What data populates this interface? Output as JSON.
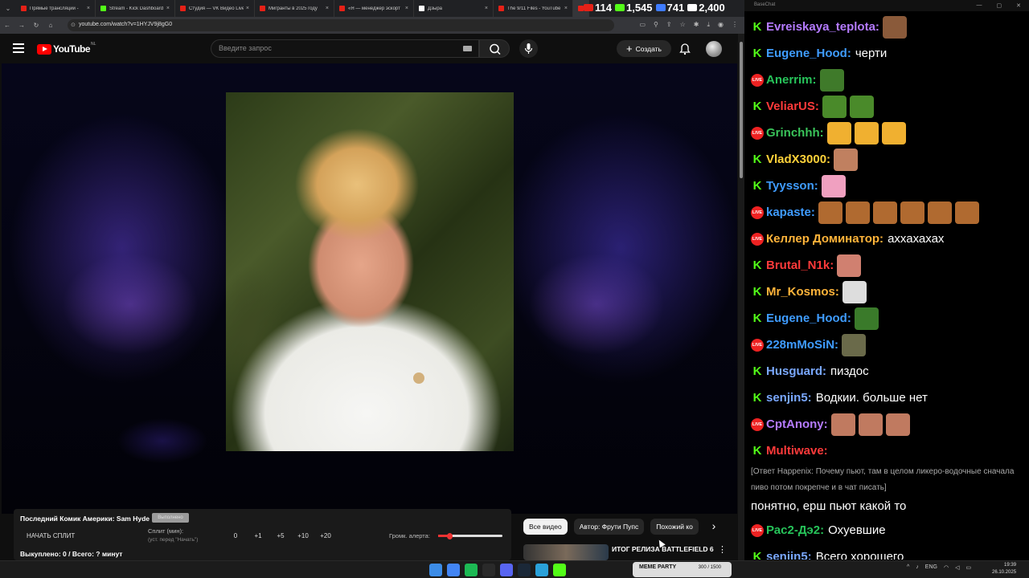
{
  "browser": {
    "tabs": [
      {
        "title": "Прямые трансляции -",
        "fav": "#e62117"
      },
      {
        "title": "Stream - Kick Dashboard",
        "fav": "#53fc18"
      },
      {
        "title": "Студия — VK Видео Live",
        "fav": "#e62117"
      },
      {
        "title": "Мигранты в 2025 году",
        "fav": "#e62117"
      },
      {
        "title": "«Я — менеджер эскорт",
        "fav": "#e62117"
      },
      {
        "title": "Дзыра",
        "fav": "#ffffff"
      },
      {
        "title": "The 9/11 Files - YouTube",
        "fav": "#e62117"
      },
      {
        "title": "Ko",
        "fav": "#e62117"
      }
    ],
    "url": "youtube.com/watch?v=1HYJV9j8gG0"
  },
  "stats": [
    {
      "value": "114",
      "color": "#e62117"
    },
    {
      "value": "1,545",
      "color": "#53fc18"
    },
    {
      "value": "741",
      "color": "#3f7cff"
    },
    {
      "value": "2,400",
      "color": "#ffffff"
    }
  ],
  "youtube": {
    "logo_text": "YouTube",
    "country": "NL",
    "search_placeholder": "Введите запрос",
    "create_label": "Создать"
  },
  "split": {
    "title": "Последний Комик Америки: Sam Hyde",
    "tag": "Выполнено",
    "start_label": "НАЧАТЬ СПЛИТ",
    "split_label": "Сплит (мин):",
    "split_hint": "(уст. перед \"Начать\")",
    "steps": [
      "0",
      "+1",
      "+5",
      "+10",
      "+20"
    ],
    "volume_label": "Громк. алерта:",
    "volume_level": 0.17,
    "bought": "Выкуплено: 0 / Всего: ? минут"
  },
  "chips": [
    "Все видео",
    "Автор: Фрути Пупс",
    "Похожий ко"
  ],
  "recommendation": {
    "title": "ИТОГ РЕЛИЗА BATTLEFIELD 6"
  },
  "chat": {
    "window_title": "BaseChat",
    "messages": [
      {
        "src": "k",
        "user": "Evreiskaya_teplota:",
        "color": "#b57bff",
        "text": "",
        "emotes": [
          "#8a5a3a"
        ]
      },
      {
        "src": "k",
        "user": "Eugene_Hood:",
        "color": "#3f9cff",
        "text": "черти",
        "emotes": []
      },
      {
        "src": "l",
        "user": "Anerrim:",
        "color": "#27c45a",
        "text": "",
        "emotes": [
          "#3f7a2a"
        ]
      },
      {
        "src": "k",
        "user": "VeliarUS:",
        "color": "#ff3a3a",
        "text": "",
        "emotes": [
          "#4a8a2a",
          "#4a8a2a"
        ]
      },
      {
        "src": "l",
        "user": "Grinchhh:",
        "color": "#3ac45a",
        "text": "",
        "emotes": [
          "#f0b030",
          "#f0b030",
          "#f0b030"
        ]
      },
      {
        "src": "k",
        "user": "VladX3000:",
        "color": "#ffd23a",
        "text": "",
        "emotes": [
          "#c08060"
        ]
      },
      {
        "src": "k",
        "user": "Tyysson:",
        "color": "#3f9cff",
        "text": "",
        "emotes": [
          "#f0a0c0"
        ]
      },
      {
        "src": "l",
        "user": "kapaste:",
        "color": "#3f9cff",
        "text": "",
        "emotes": [
          "#b06a30",
          "#b06a30",
          "#b06a30",
          "#b06a30",
          "#b06a30",
          "#b06a30"
        ]
      },
      {
        "src": "l",
        "user": "Келлер Доминатор:",
        "color": "#ffb43a",
        "text": "аххахахах",
        "emotes": []
      },
      {
        "src": "k",
        "user": "Brutal_N1k:",
        "color": "#ff3a3a",
        "text": "",
        "emotes": [
          "#d08070"
        ]
      },
      {
        "src": "k",
        "user": "Mr_Kosmos:",
        "color": "#ffb43a",
        "text": "",
        "emotes": [
          "#dddddd"
        ]
      },
      {
        "src": "k",
        "user": "Eugene_Hood:",
        "color": "#3f9cff",
        "text": "",
        "emotes": [
          "#3a7a2a"
        ]
      },
      {
        "src": "l",
        "user": "228mMoSiN:",
        "color": "#3f9cff",
        "text": "",
        "emotes": [
          "#6a6a4a"
        ]
      },
      {
        "src": "k",
        "user": "Husguard:",
        "color": "#7aa8ff",
        "text": "пиздос",
        "emotes": []
      },
      {
        "src": "k",
        "user": "senjin5:",
        "color": "#7aa8ff",
        "text": "Водкии. больше нет",
        "emotes": []
      },
      {
        "src": "l",
        "user": "CptAnony:",
        "color": "#b57bff",
        "text": "",
        "emotes": [
          "#c07a60",
          "#c07a60",
          "#c07a60"
        ]
      },
      {
        "src": "k",
        "user": "Multiwave:",
        "color": "#ff3a3a",
        "text": "",
        "emotes": []
      },
      {
        "src": "reply",
        "text": "[Ответ Happenix: Почему пьют, там в целом ликеро-водочные сначала пиво потом покрепче и в чат писать]"
      },
      {
        "src": "cont",
        "text": "понятно, ерш пьют какой то"
      },
      {
        "src": "l",
        "user": "Рас2-Дэ2:",
        "color": "#27c45a",
        "text": "Охуевшие",
        "emotes": []
      },
      {
        "src": "k",
        "user": "senjin5:",
        "color": "#7aa8ff",
        "text": "Всего хорошего",
        "emotes": []
      }
    ]
  },
  "taskbar": {
    "badge": "MEME PARTY",
    "badge_count": "300 / 1500",
    "lang": "ENG",
    "time": "19:39",
    "date": "26.10.2025",
    "icons": [
      "#3c8ce7",
      "#4285f4",
      "#1db954",
      "#2a2a2a",
      "#5865f2",
      "#1b2838",
      "#2aa1d9",
      "#53fc18"
    ]
  }
}
